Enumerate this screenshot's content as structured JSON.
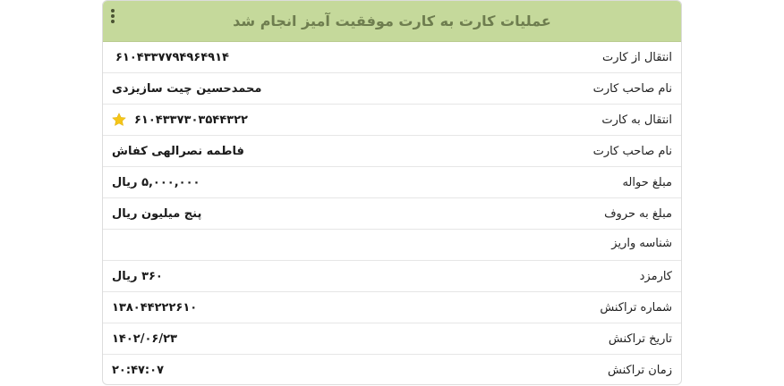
{
  "header": {
    "title": "عملیات کارت به کارت موفقیت آمیز انجام شد"
  },
  "rows": [
    {
      "label": "انتقال از کارت",
      "value": "۶۱۰۴۳۳۷۷۹۴۹۶۴۹۱۴"
    },
    {
      "label": "نام صاحب کارت",
      "value": "محمدحسین چیت سازیزدی"
    },
    {
      "label": "انتقال به کارت",
      "value": "۶۱۰۴۳۳۷۳۰۳۵۴۴۳۲۲",
      "starred": true
    },
    {
      "label": "نام صاحب کارت",
      "value": "فاطمه نصرالهی کفاش"
    },
    {
      "label": "مبلغ حواله",
      "value": "۵,۰۰۰,۰۰۰ ریال"
    },
    {
      "label": "مبلغ به حروف",
      "value": "پنج میلیون ریال"
    },
    {
      "label": "شناسه واریز",
      "value": ""
    },
    {
      "label": "کارمزد",
      "value": "۳۶۰ ریال"
    },
    {
      "label": "شماره تراکنش",
      "value": "۱۳۸۰۴۴۲۲۲۶۱۰"
    },
    {
      "label": "تاریخ تراکنش",
      "value": "۱۴۰۲/۰۶/۲۳"
    },
    {
      "label": "زمان تراکنش",
      "value": "۲۰:۴۷:۰۷"
    }
  ],
  "colors": {
    "header_bg": "#c5d99b",
    "header_text": "#6e7d4f",
    "star": "#f5c518"
  },
  "icons": {
    "menu": "kebab-menu-icon",
    "favorite": "star-icon"
  }
}
